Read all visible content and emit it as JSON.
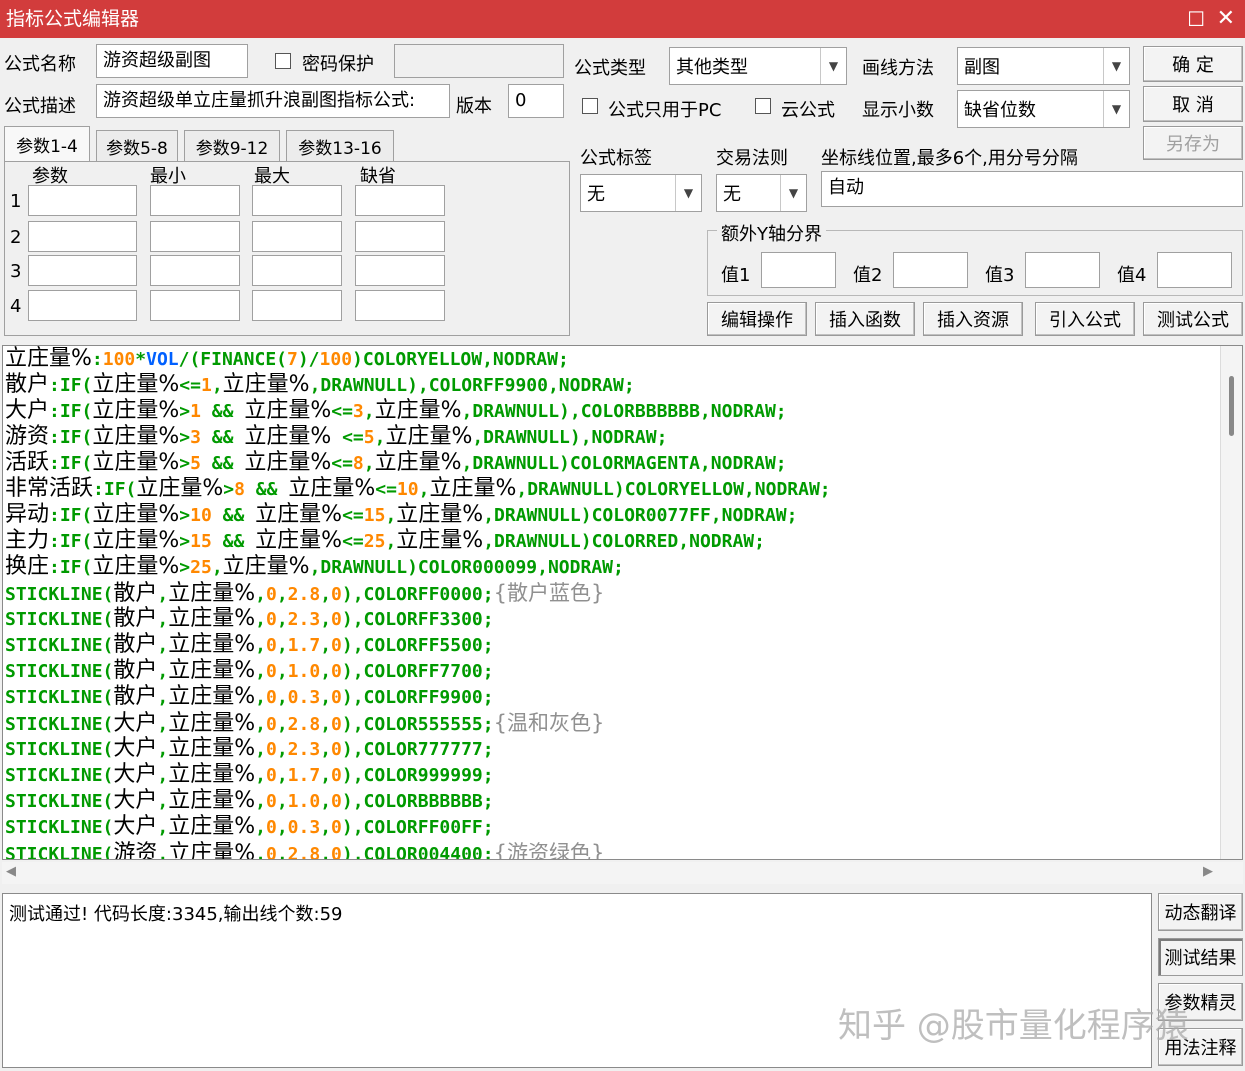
{
  "window": {
    "title": "指标公式编辑器",
    "max_glyph": "☐",
    "close_glyph": "✕"
  },
  "form": {
    "name_label": "公式名称",
    "name_value": "游资超级副图",
    "password_label": "密码保护",
    "desc_label": "公式描述",
    "desc_value": "游资超级单立庄量抓升浪副图指标公式:",
    "version_label": "版本",
    "version_value": "0",
    "type_label": "公式类型",
    "type_value": "其他类型",
    "draw_label": "画线方法",
    "draw_value": "副图",
    "pc_only_label": "公式只用于PC",
    "cloud_label": "云公式",
    "decimals_label": "显示小数",
    "decimals_value": "缺省位数",
    "tag_label": "公式标签",
    "tag_value": "无",
    "trade_label": "交易法则",
    "trade_value": "无",
    "axis_label": "坐标线位置,最多6个,用分号分隔",
    "axis_value": "自动",
    "yaxis_group": "额外Y轴分界",
    "yvals": [
      "值1",
      "值2",
      "值3",
      "值4"
    ]
  },
  "buttons": {
    "ok": "确 定",
    "cancel": "取 消",
    "save_as": "另存为",
    "edit_ops": "编辑操作",
    "insert_func": "插入函数",
    "insert_res": "插入资源",
    "import": "引入公式",
    "test": "测试公式",
    "translate": "动态翻译",
    "test_result": "测试结果",
    "param_wizard": "参数精灵",
    "usage": "用法注释"
  },
  "params": {
    "tabs": [
      "参数1-4",
      "参数5-8",
      "参数9-12",
      "参数13-16"
    ],
    "headers": [
      "参数",
      "最小",
      "最大",
      "缺省"
    ],
    "rows": [
      "1",
      "2",
      "3",
      "4"
    ]
  },
  "code_lines": [
    [
      [
        "n",
        "立庄量%"
      ],
      [
        "k",
        ":"
      ],
      [
        "v",
        "100"
      ],
      [
        "k",
        "*"
      ],
      [
        "b",
        "VOL"
      ],
      [
        "k",
        "/(FINANCE("
      ],
      [
        "v",
        "7"
      ],
      [
        "k",
        ")/"
      ],
      [
        "v",
        "100"
      ],
      [
        "k",
        ")COLORYELLOW,NODRAW;"
      ]
    ],
    [
      [
        "n",
        "散户"
      ],
      [
        "k",
        ":IF("
      ],
      [
        "n",
        "立庄量%"
      ],
      [
        "k",
        "<="
      ],
      [
        "v",
        "1"
      ],
      [
        "k",
        ","
      ],
      [
        "n",
        "立庄量%"
      ],
      [
        "k",
        ",DRAWNULL),COLORFF9900,NODRAW;"
      ]
    ],
    [
      [
        "n",
        "大户"
      ],
      [
        "k",
        ":IF("
      ],
      [
        "n",
        "立庄量%"
      ],
      [
        "k",
        ">"
      ],
      [
        "v",
        "1"
      ],
      [
        "k",
        " && "
      ],
      [
        "n",
        "立庄量%"
      ],
      [
        "k",
        "<="
      ],
      [
        "v",
        "3"
      ],
      [
        "k",
        ","
      ],
      [
        "n",
        "立庄量%"
      ],
      [
        "k",
        ",DRAWNULL),COLORBBBBBB,NODRAW;"
      ]
    ],
    [
      [
        "n",
        "游资"
      ],
      [
        "k",
        ":IF("
      ],
      [
        "n",
        "立庄量%"
      ],
      [
        "k",
        ">"
      ],
      [
        "v",
        "3"
      ],
      [
        "k",
        " && "
      ],
      [
        "n",
        "立庄量%"
      ],
      [
        "k",
        " <="
      ],
      [
        "v",
        "5"
      ],
      [
        "k",
        ","
      ],
      [
        "n",
        "立庄量%"
      ],
      [
        "k",
        ",DRAWNULL),NODRAW;"
      ]
    ],
    [
      [
        "n",
        "活跃"
      ],
      [
        "k",
        ":IF("
      ],
      [
        "n",
        "立庄量%"
      ],
      [
        "k",
        ">"
      ],
      [
        "v",
        "5"
      ],
      [
        "k",
        " && "
      ],
      [
        "n",
        "立庄量%"
      ],
      [
        "k",
        "<="
      ],
      [
        "v",
        "8"
      ],
      [
        "k",
        ","
      ],
      [
        "n",
        "立庄量%"
      ],
      [
        "k",
        ",DRAWNULL)COLORMAGENTA,NODRAW;"
      ]
    ],
    [
      [
        "n",
        "非常活跃"
      ],
      [
        "k",
        ":IF("
      ],
      [
        "n",
        "立庄量%"
      ],
      [
        "k",
        ">"
      ],
      [
        "v",
        "8"
      ],
      [
        "k",
        " && "
      ],
      [
        "n",
        "立庄量%"
      ],
      [
        "k",
        "<="
      ],
      [
        "v",
        "10"
      ],
      [
        "k",
        ","
      ],
      [
        "n",
        "立庄量%"
      ],
      [
        "k",
        ",DRAWNULL)COLORYELLOW,NODRAW;"
      ]
    ],
    [
      [
        "n",
        "异动"
      ],
      [
        "k",
        ":IF("
      ],
      [
        "n",
        "立庄量%"
      ],
      [
        "k",
        ">"
      ],
      [
        "v",
        "10"
      ],
      [
        "k",
        " && "
      ],
      [
        "n",
        "立庄量%"
      ],
      [
        "k",
        "<="
      ],
      [
        "v",
        "15"
      ],
      [
        "k",
        ","
      ],
      [
        "n",
        "立庄量%"
      ],
      [
        "k",
        ",DRAWNULL)COLOR0077FF,NODRAW;"
      ]
    ],
    [
      [
        "n",
        "主力"
      ],
      [
        "k",
        ":IF("
      ],
      [
        "n",
        "立庄量%"
      ],
      [
        "k",
        ">"
      ],
      [
        "v",
        "15"
      ],
      [
        "k",
        " && "
      ],
      [
        "n",
        "立庄量%"
      ],
      [
        "k",
        "<="
      ],
      [
        "v",
        "25"
      ],
      [
        "k",
        ","
      ],
      [
        "n",
        "立庄量%"
      ],
      [
        "k",
        ",DRAWNULL)COLORRED,NODRAW;"
      ]
    ],
    [
      [
        "n",
        "换庄"
      ],
      [
        "k",
        ":IF("
      ],
      [
        "n",
        "立庄量%"
      ],
      [
        "k",
        ">"
      ],
      [
        "v",
        "25"
      ],
      [
        "k",
        ","
      ],
      [
        "n",
        "立庄量%"
      ],
      [
        "k",
        ",DRAWNULL)COLOR000099,NODRAW;"
      ]
    ],
    [
      [
        "k",
        "STICKLINE("
      ],
      [
        "n",
        "散户"
      ],
      [
        "k",
        ","
      ],
      [
        "n",
        "立庄量%"
      ],
      [
        "k",
        ","
      ],
      [
        "v",
        "0"
      ],
      [
        "k",
        ","
      ],
      [
        "v",
        "2.8"
      ],
      [
        "k",
        ","
      ],
      [
        "v",
        "0"
      ],
      [
        "k",
        "),COLORFF0000;"
      ],
      [
        "c",
        "{散户蓝色}"
      ]
    ],
    [
      [
        "k",
        "STICKLINE("
      ],
      [
        "n",
        "散户"
      ],
      [
        "k",
        ","
      ],
      [
        "n",
        "立庄量%"
      ],
      [
        "k",
        ","
      ],
      [
        "v",
        "0"
      ],
      [
        "k",
        ","
      ],
      [
        "v",
        "2.3"
      ],
      [
        "k",
        ","
      ],
      [
        "v",
        "0"
      ],
      [
        "k",
        "),COLORFF3300;"
      ]
    ],
    [
      [
        "k",
        "STICKLINE("
      ],
      [
        "n",
        "散户"
      ],
      [
        "k",
        ","
      ],
      [
        "n",
        "立庄量%"
      ],
      [
        "k",
        ","
      ],
      [
        "v",
        "0"
      ],
      [
        "k",
        ","
      ],
      [
        "v",
        "1.7"
      ],
      [
        "k",
        ","
      ],
      [
        "v",
        "0"
      ],
      [
        "k",
        "),COLORFF5500;"
      ]
    ],
    [
      [
        "k",
        "STICKLINE("
      ],
      [
        "n",
        "散户"
      ],
      [
        "k",
        ","
      ],
      [
        "n",
        "立庄量%"
      ],
      [
        "k",
        ","
      ],
      [
        "v",
        "0"
      ],
      [
        "k",
        ","
      ],
      [
        "v",
        "1.0"
      ],
      [
        "k",
        ","
      ],
      [
        "v",
        "0"
      ],
      [
        "k",
        "),COLORFF7700;"
      ]
    ],
    [
      [
        "k",
        "STICKLINE("
      ],
      [
        "n",
        "散户"
      ],
      [
        "k",
        ","
      ],
      [
        "n",
        "立庄量%"
      ],
      [
        "k",
        ","
      ],
      [
        "v",
        "0"
      ],
      [
        "k",
        ","
      ],
      [
        "v",
        "0.3"
      ],
      [
        "k",
        ","
      ],
      [
        "v",
        "0"
      ],
      [
        "k",
        "),COLORFF9900;"
      ]
    ],
    [
      [
        "k",
        "STICKLINE("
      ],
      [
        "n",
        "大户"
      ],
      [
        "k",
        ","
      ],
      [
        "n",
        "立庄量%"
      ],
      [
        "k",
        ","
      ],
      [
        "v",
        "0"
      ],
      [
        "k",
        ","
      ],
      [
        "v",
        "2.8"
      ],
      [
        "k",
        ","
      ],
      [
        "v",
        "0"
      ],
      [
        "k",
        "),COLOR555555;"
      ],
      [
        "c",
        "{温和灰色}"
      ]
    ],
    [
      [
        "k",
        "STICKLINE("
      ],
      [
        "n",
        "大户"
      ],
      [
        "k",
        ","
      ],
      [
        "n",
        "立庄量%"
      ],
      [
        "k",
        ","
      ],
      [
        "v",
        "0"
      ],
      [
        "k",
        ","
      ],
      [
        "v",
        "2.3"
      ],
      [
        "k",
        ","
      ],
      [
        "v",
        "0"
      ],
      [
        "k",
        "),COLOR777777;"
      ]
    ],
    [
      [
        "k",
        "STICKLINE("
      ],
      [
        "n",
        "大户"
      ],
      [
        "k",
        ","
      ],
      [
        "n",
        "立庄量%"
      ],
      [
        "k",
        ","
      ],
      [
        "v",
        "0"
      ],
      [
        "k",
        ","
      ],
      [
        "v",
        "1.7"
      ],
      [
        "k",
        ","
      ],
      [
        "v",
        "0"
      ],
      [
        "k",
        "),COLOR999999;"
      ]
    ],
    [
      [
        "k",
        "STICKLINE("
      ],
      [
        "n",
        "大户"
      ],
      [
        "k",
        ","
      ],
      [
        "n",
        "立庄量%"
      ],
      [
        "k",
        ","
      ],
      [
        "v",
        "0"
      ],
      [
        "k",
        ","
      ],
      [
        "v",
        "1.0"
      ],
      [
        "k",
        ","
      ],
      [
        "v",
        "0"
      ],
      [
        "k",
        "),COLORBBBBBB;"
      ]
    ],
    [
      [
        "k",
        "STICKLINE("
      ],
      [
        "n",
        "大户"
      ],
      [
        "k",
        ","
      ],
      [
        "n",
        "立庄量%"
      ],
      [
        "k",
        ","
      ],
      [
        "v",
        "0"
      ],
      [
        "k",
        ","
      ],
      [
        "v",
        "0.3"
      ],
      [
        "k",
        ","
      ],
      [
        "v",
        "0"
      ],
      [
        "k",
        "),COLORFF00FF;"
      ]
    ],
    [
      [
        "k",
        "STICKLINE("
      ],
      [
        "n",
        "游资"
      ],
      [
        "k",
        ","
      ],
      [
        "n",
        "立庄量%"
      ],
      [
        "k",
        ","
      ],
      [
        "v",
        "0"
      ],
      [
        "k",
        ","
      ],
      [
        "v",
        "2.8"
      ],
      [
        "k",
        ","
      ],
      [
        "v",
        "0"
      ],
      [
        "k",
        "),COLOR004400;"
      ],
      [
        "c",
        "{游资绿色}"
      ]
    ]
  ],
  "output_text": "测试通过! 代码长度:3345,输出线个数:59",
  "watermark": "知乎 @股市量化程序猿",
  "colors": {
    "title_bar": "#d23c3c",
    "keyword": "#009a00",
    "number": "#ff8800",
    "builtin": "#0060ff",
    "comment": "#909090"
  }
}
